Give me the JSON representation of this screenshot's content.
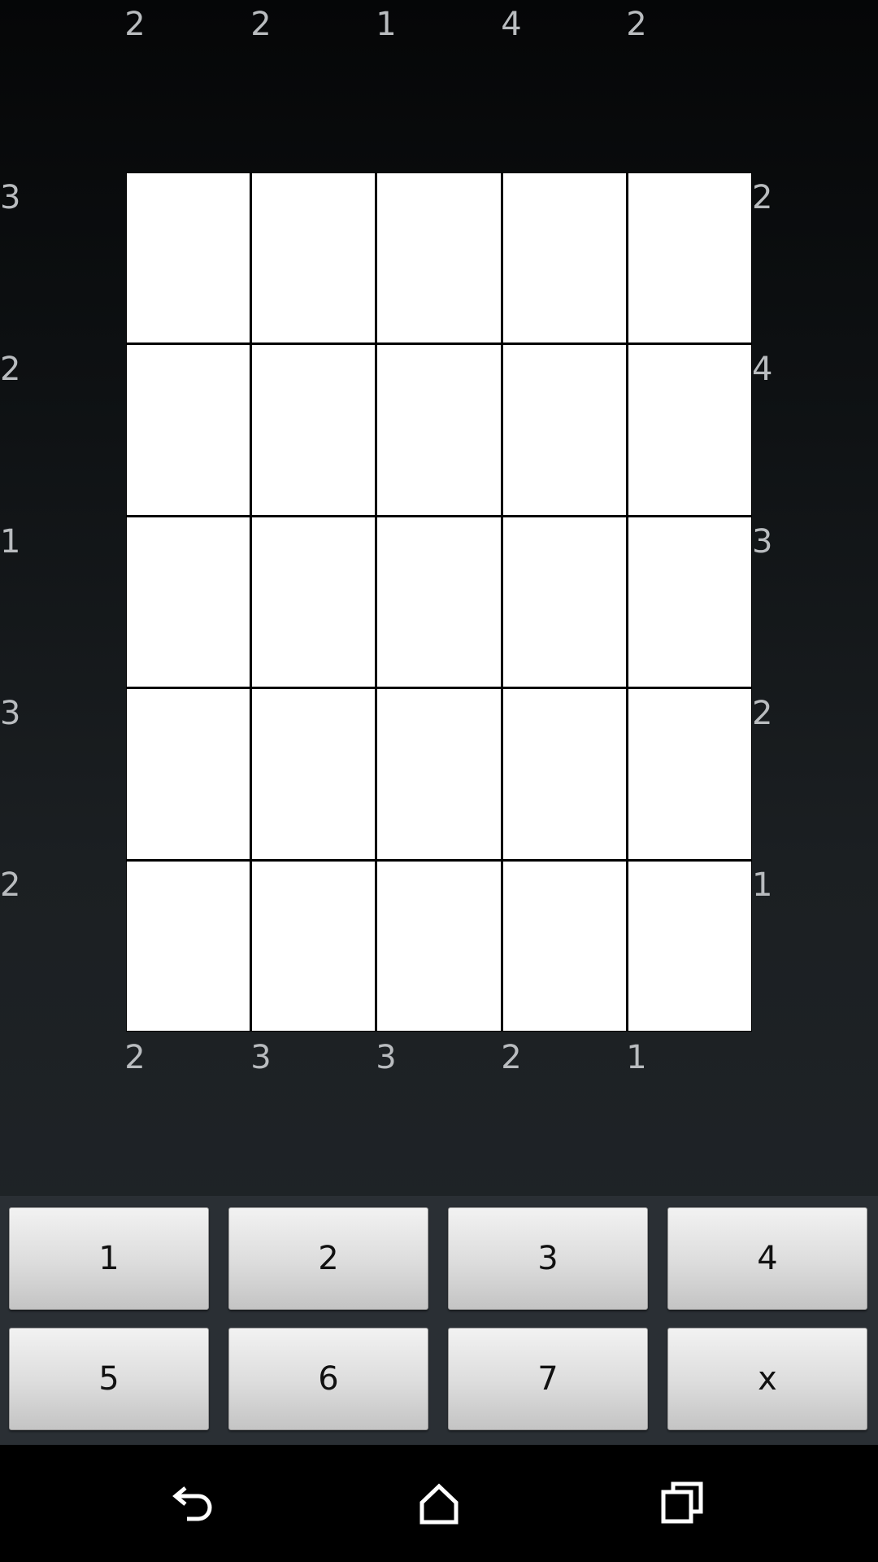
{
  "puzzle": {
    "top_clues": [
      "2",
      "2",
      "1",
      "4",
      "2"
    ],
    "bottom_clues": [
      "2",
      "3",
      "3",
      "2",
      "1"
    ],
    "left_clues": [
      "3",
      "2",
      "1",
      "3",
      "2"
    ],
    "right_clues": [
      "2",
      "4",
      "3",
      "2",
      "1"
    ]
  },
  "keypad": {
    "keys": [
      "1",
      "2",
      "3",
      "4",
      "5",
      "6",
      "7",
      "x"
    ]
  },
  "navbar": {
    "icons": [
      "back-icon",
      "home-icon",
      "recents-icon"
    ]
  },
  "colors": {
    "cell": "#ffffff",
    "grid_line": "#000000",
    "clue_text": "#b9bcbf",
    "keypad_bg": "#2a2f34"
  }
}
